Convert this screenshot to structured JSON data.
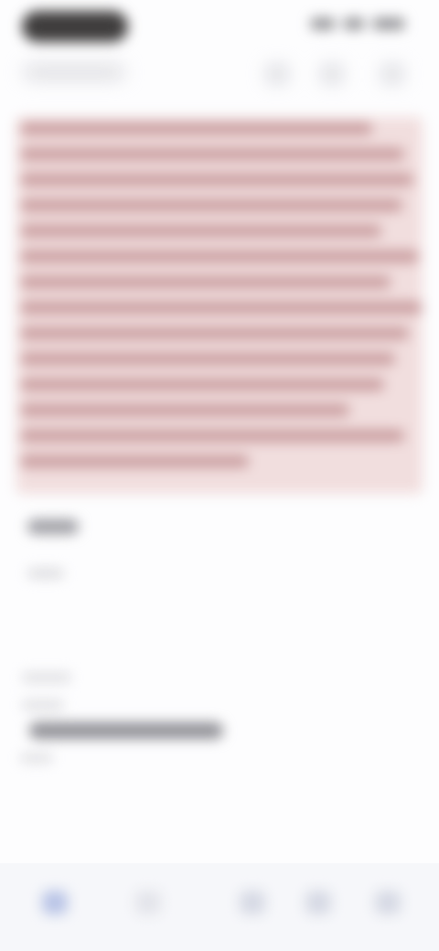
{
  "status_bar": {
    "pill_color": "#3f3d3d",
    "icons": [
      "signal-icon",
      "wifi-icon",
      "battery-icon"
    ]
  },
  "top_bar": {
    "back_icon": "chevron-left-icon",
    "actions": [
      "share-icon",
      "bookmark-icon",
      "more-icon"
    ]
  },
  "highlight": {
    "background_color": "#f1dede",
    "line_color": "#c79a9c",
    "line_count": 14
  },
  "bottom_nav": {
    "active_color": "#b9c4e6",
    "items": [
      "home-icon",
      "search-icon",
      "library-icon",
      "profile-icon",
      "menu-icon"
    ]
  }
}
